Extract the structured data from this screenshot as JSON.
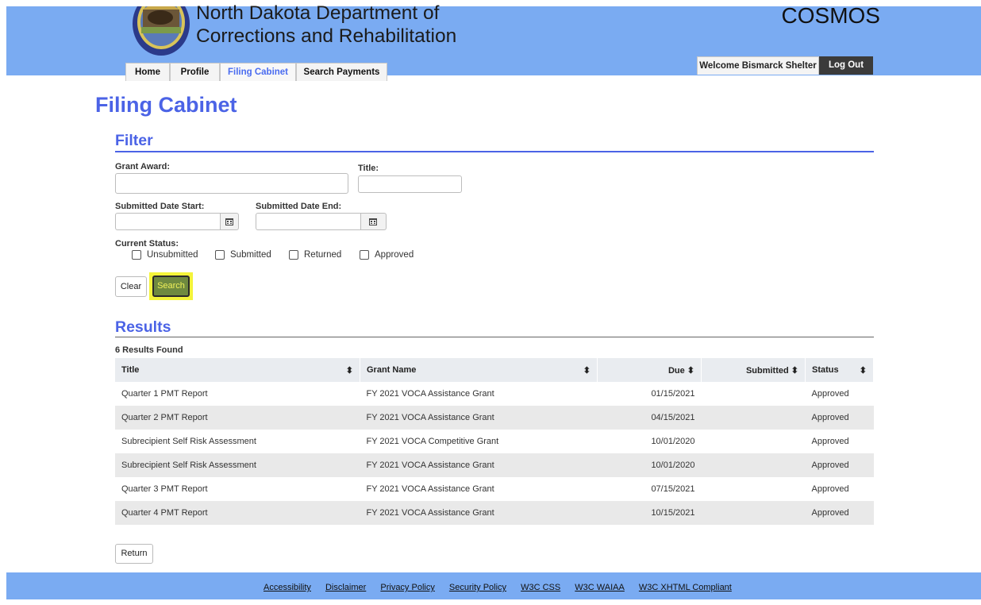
{
  "header": {
    "agency_line1": "North Dakota Department of",
    "agency_line2": "Corrections and Rehabilitation",
    "app_name": "COSMOS",
    "tabs": [
      {
        "label": "Home"
      },
      {
        "label": "Profile"
      },
      {
        "label": "Filing Cabinet"
      },
      {
        "label": "Search Payments"
      }
    ],
    "welcome": "Welcome Bismarck Shelter",
    "logout": "Log Out"
  },
  "page": {
    "title": "Filing Cabinet"
  },
  "filter": {
    "heading": "Filter",
    "grant_award_label": "Grant Award:",
    "grant_award_value": "",
    "title_label": "Title:",
    "title_value": "",
    "date_start_label": "Submitted Date Start:",
    "date_start_value": "",
    "date_end_label": "Submitted Date End:",
    "date_end_value": "",
    "status_label": "Current Status:",
    "statuses": [
      "Unsubmitted",
      "Submitted",
      "Returned",
      "Approved"
    ],
    "clear_label": "Clear",
    "search_label": "Search"
  },
  "results": {
    "heading": "Results",
    "count_text": "6 Results Found",
    "columns": [
      "Title",
      "Grant Name",
      "Due",
      "Submitted",
      "Status"
    ],
    "rows": [
      {
        "title": "Quarter 1 PMT Report",
        "grant": "FY 2021 VOCA Assistance Grant",
        "due": "01/15/2021",
        "submitted": "",
        "status": "Approved"
      },
      {
        "title": "Quarter 2 PMT Report",
        "grant": "FY 2021 VOCA Assistance Grant",
        "due": "04/15/2021",
        "submitted": "",
        "status": "Approved"
      },
      {
        "title": "Subrecipient Self Risk Assessment",
        "grant": "FY 2021 VOCA Competitive Grant",
        "due": "10/01/2020",
        "submitted": "",
        "status": "Approved"
      },
      {
        "title": "Subrecipient Self Risk Assessment",
        "grant": "FY 2021 VOCA Assistance Grant",
        "due": "10/01/2020",
        "submitted": "",
        "status": "Approved"
      },
      {
        "title": "Quarter 3 PMT Report",
        "grant": "FY 2021 VOCA Assistance Grant",
        "due": "07/15/2021",
        "submitted": "",
        "status": "Approved"
      },
      {
        "title": "Quarter 4 PMT Report",
        "grant": "FY 2021 VOCA Assistance Grant",
        "due": "10/15/2021",
        "submitted": "",
        "status": "Approved"
      }
    ]
  },
  "return_label": "Return",
  "footer": {
    "links": [
      "Accessibility",
      "Disclaimer",
      "Privacy Policy",
      "Security Policy",
      "W3C CSS",
      "W3C WAIAA",
      "W3C XHTML Compliant"
    ]
  },
  "colors": {
    "header_bg": "#7aabf2",
    "accent": "#4b63e6",
    "search_highlight": "#f4f43a"
  },
  "icons": {
    "seal": "department-seal-icon",
    "calendar": "calendar-icon",
    "sort": "sort-icon"
  }
}
